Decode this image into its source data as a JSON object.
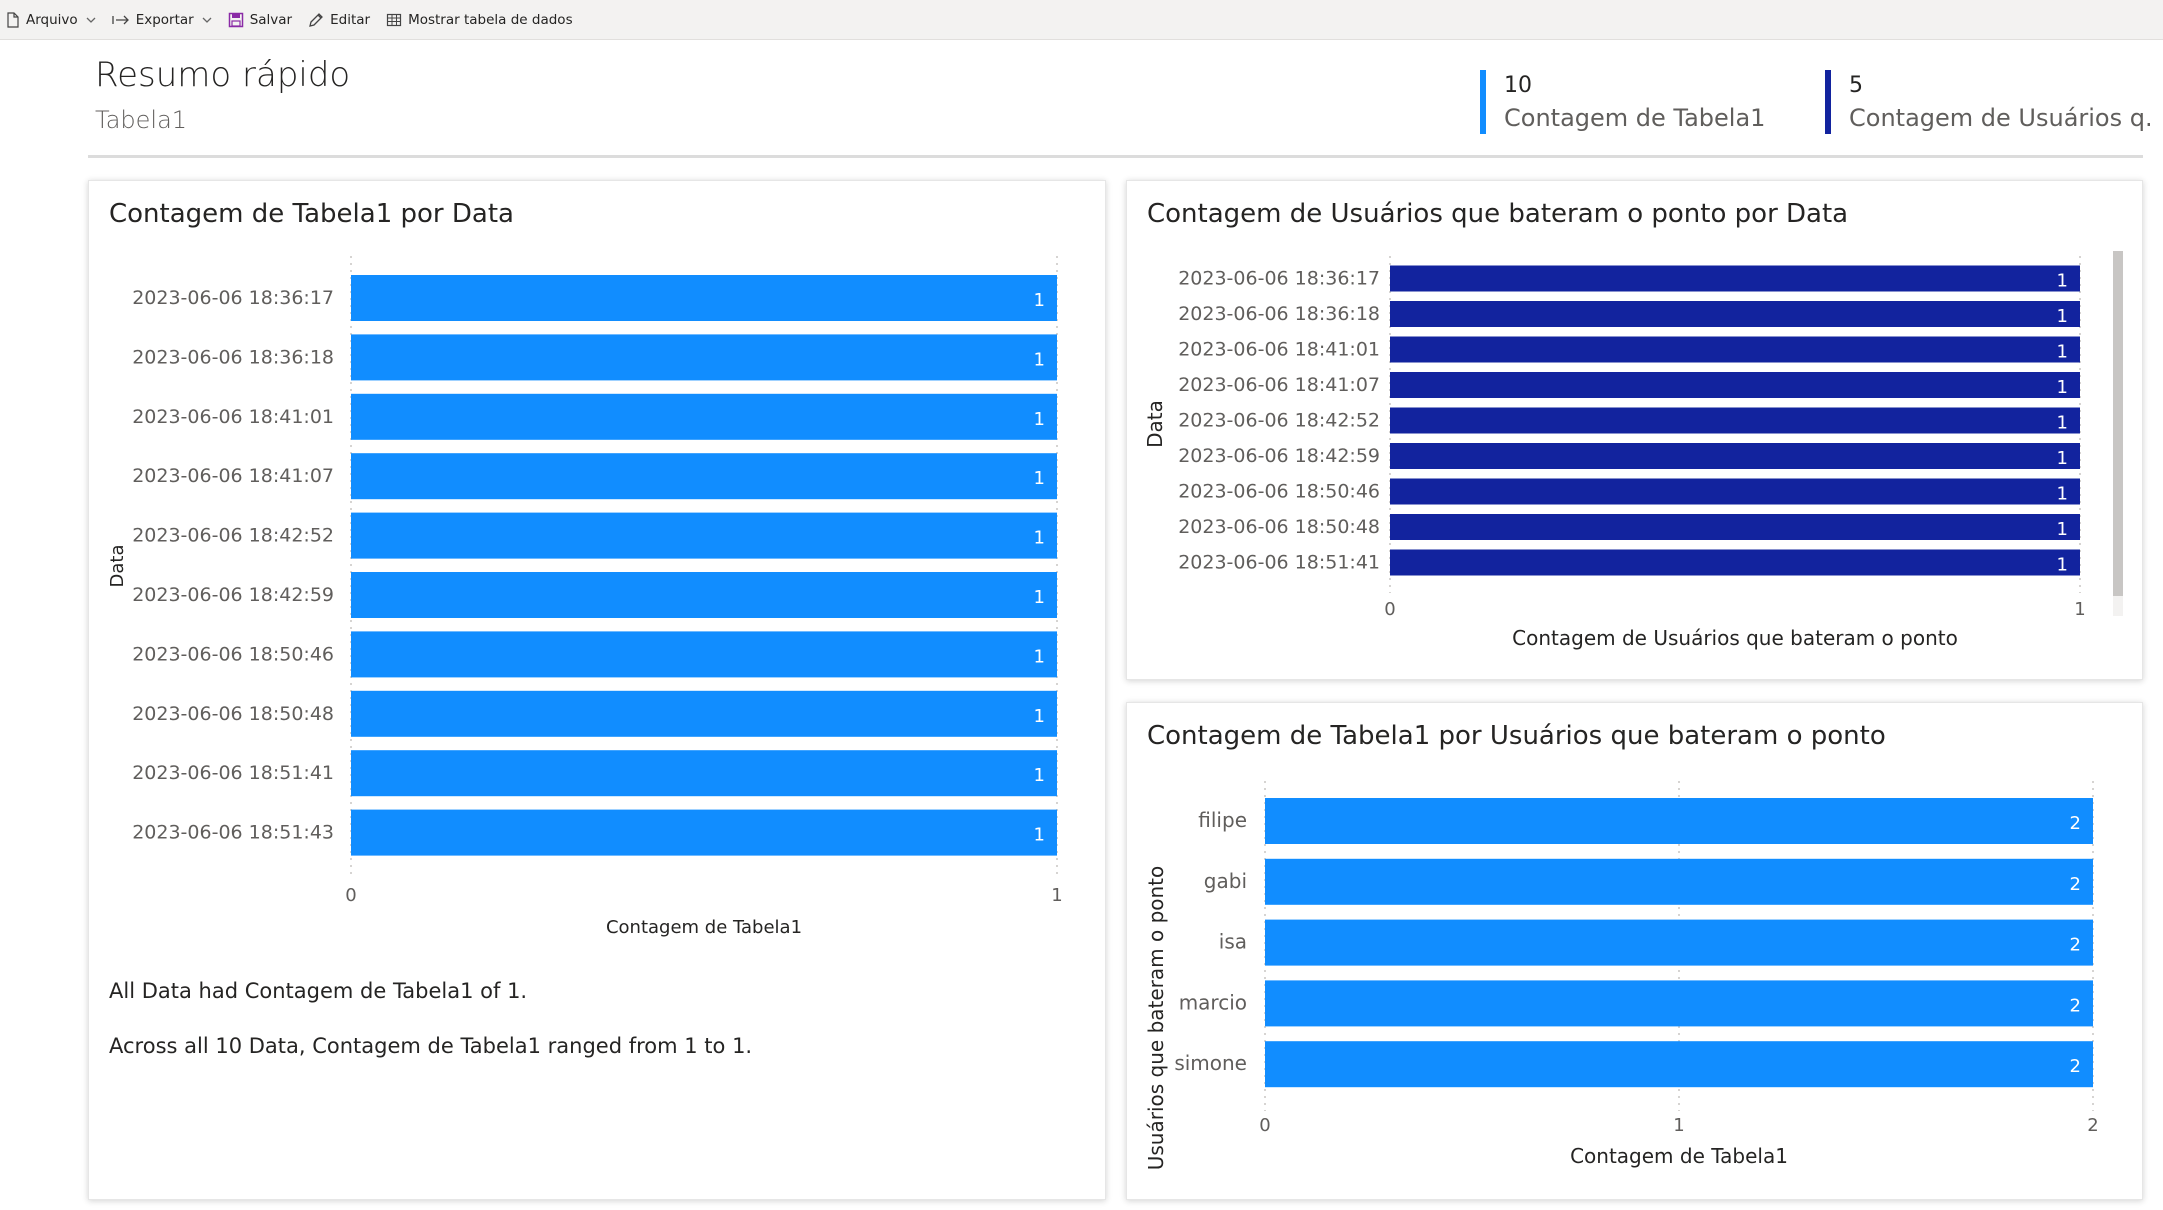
{
  "toolbar": {
    "arquivo": "Arquivo",
    "exportar": "Exportar",
    "salvar": "Salvar",
    "editar": "Editar",
    "mostrar": "Mostrar tabela de dados"
  },
  "header": {
    "title": "Resumo rápido",
    "subtitle": "Tabela1"
  },
  "kpis": [
    {
      "value": "10",
      "label": "Contagem de Tabela1",
      "color": "#118dff"
    },
    {
      "value": "5",
      "label": "Contagem de Usuários q...",
      "color": "#12239e"
    }
  ],
  "colors": {
    "bar_light": "#118dff",
    "bar_dark": "#12239e",
    "scrollbar": "#c8c6c4"
  },
  "cards": {
    "by_date": {
      "title": "Contagem de Tabela1 por Data"
    },
    "users_by_date": {
      "title": "Contagem de Usuários que bateram o ponto por Data"
    },
    "by_user": {
      "title": "Contagem de Tabela1 por Usuários que bateram o ponto"
    }
  },
  "insights": [
    "All Data had Contagem de Tabela1 of 1.",
    "Across all 10 Data, Contagem de Tabela1 ranged from 1 to 1."
  ],
  "chart_data": [
    {
      "type": "bar",
      "orientation": "horizontal",
      "title": "Contagem de Tabela1 por Data",
      "xlabel": "Contagem de Tabela1",
      "ylabel": "Data",
      "categories": [
        "2023-06-06 18:36:17",
        "2023-06-06 18:36:18",
        "2023-06-06 18:41:01",
        "2023-06-06 18:41:07",
        "2023-06-06 18:42:52",
        "2023-06-06 18:42:59",
        "2023-06-06 18:50:46",
        "2023-06-06 18:50:48",
        "2023-06-06 18:51:41",
        "2023-06-06 18:51:43"
      ],
      "values": [
        1,
        1,
        1,
        1,
        1,
        1,
        1,
        1,
        1,
        1
      ],
      "xlim": [
        0,
        1
      ],
      "xticks": [
        "0",
        "1"
      ],
      "data_labels": true,
      "color": "#118dff"
    },
    {
      "type": "bar",
      "orientation": "horizontal",
      "title": "Contagem de Usuários que bateram o ponto por Data",
      "xlabel": "Contagem de Usuários que bateram o ponto",
      "ylabel": "Data",
      "categories": [
        "2023-06-06 18:36:17",
        "2023-06-06 18:36:18",
        "2023-06-06 18:41:01",
        "2023-06-06 18:41:07",
        "2023-06-06 18:42:52",
        "2023-06-06 18:42:59",
        "2023-06-06 18:50:46",
        "2023-06-06 18:50:48",
        "2023-06-06 18:51:41"
      ],
      "values": [
        1,
        1,
        1,
        1,
        1,
        1,
        1,
        1,
        1
      ],
      "xlim": [
        0,
        1
      ],
      "xticks": [
        "0",
        "1"
      ],
      "data_labels": true,
      "color": "#12239e",
      "scrollable": true
    },
    {
      "type": "bar",
      "orientation": "horizontal",
      "title": "Contagem de Tabela1 por Usuários que bateram o ponto",
      "xlabel": "Contagem de Tabela1",
      "ylabel": "Usuários que bateram o ponto",
      "categories": [
        "filipe",
        "gabi",
        "isa",
        "marcio",
        "simone"
      ],
      "values": [
        2,
        2,
        2,
        2,
        2
      ],
      "xlim": [
        0,
        2
      ],
      "xticks": [
        "0",
        "1",
        "2"
      ],
      "data_labels": true,
      "color": "#118dff"
    }
  ]
}
